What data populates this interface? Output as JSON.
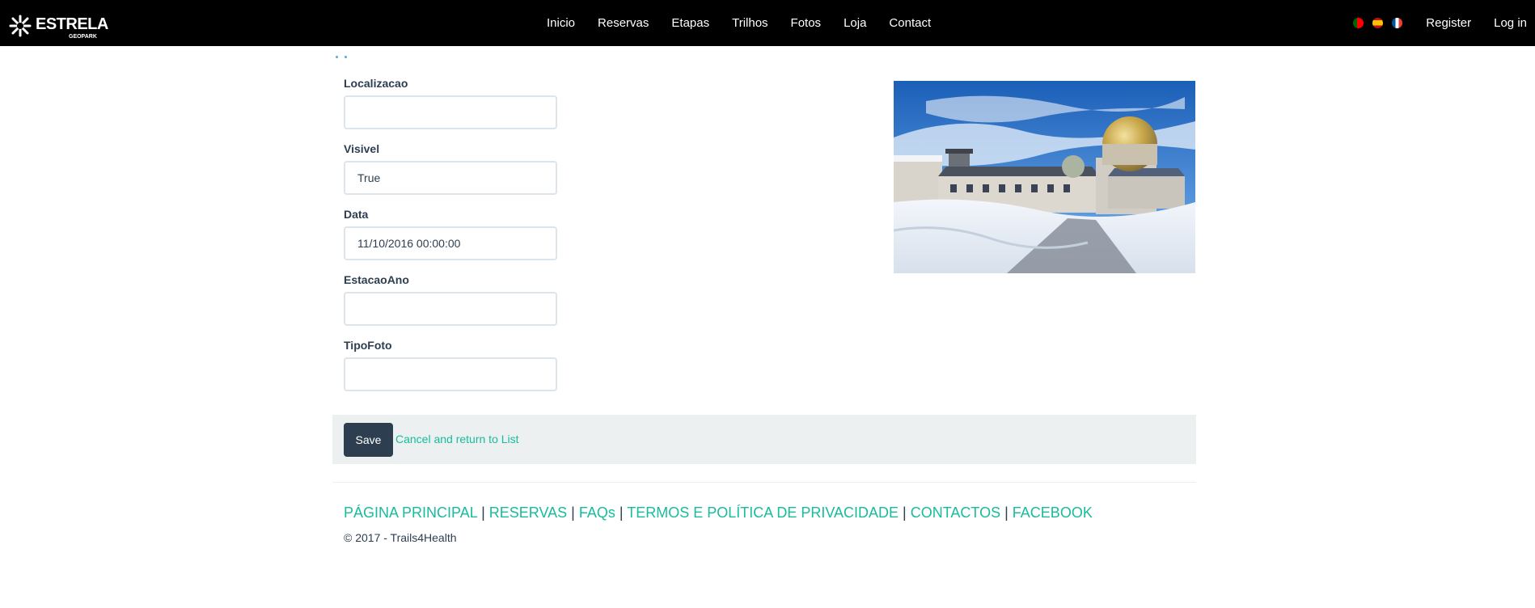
{
  "navbar": {
    "brand": {
      "name": "ESTRELA",
      "sub": "GEOPARK"
    },
    "links": [
      "Inicio",
      "Reservas",
      "Etapas",
      "Trilhos",
      "Fotos",
      "Loja",
      "Contact"
    ],
    "flags": [
      "portugal-flag-icon",
      "spain-flag-icon",
      "france-flag-icon"
    ],
    "register": "Register",
    "login": "Log in"
  },
  "form": {
    "fields": [
      {
        "label": "Localizacao",
        "value": ""
      },
      {
        "label": "Visivel",
        "value": "True"
      },
      {
        "label": "Data",
        "value": "11/10/2016 00:00:00"
      },
      {
        "label": "EstacaoAno",
        "value": ""
      },
      {
        "label": "TipoFoto",
        "value": ""
      }
    ],
    "save_label": "Save",
    "cancel_label": "Cancel and return to List"
  },
  "footer": {
    "links": [
      "PÁGINA PRINCIPAL",
      "RESERVAS",
      "FAQs",
      "TERMOS E POLÍTICA DE PRIVACIDADE",
      "CONTACTOS",
      "FACEBOOK"
    ],
    "separator": "|",
    "copyright": "© 2017 - Trails4Health"
  },
  "colors": {
    "navbar_bg": "#000000",
    "primary": "#2c3e50",
    "accent": "#18bc9c",
    "panel_bg": "#ecf0f1"
  }
}
